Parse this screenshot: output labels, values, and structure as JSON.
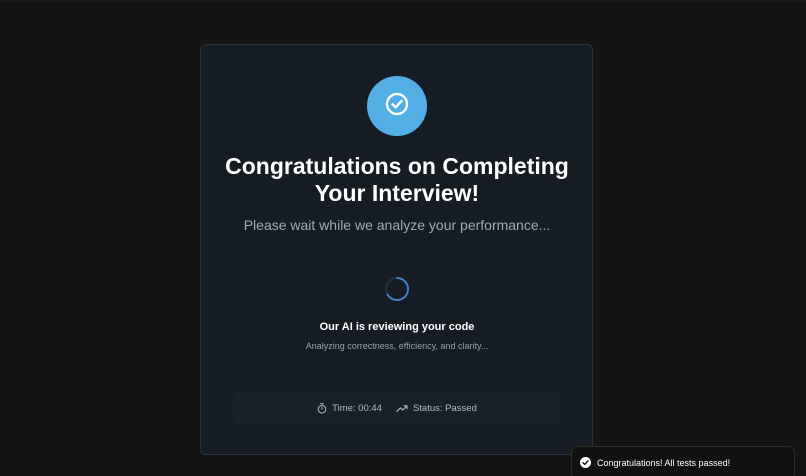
{
  "card": {
    "title": "Congratulations on Completing Your Interview!",
    "subtitle": "Please wait while we analyze your performance...",
    "review_title": "Our AI is reviewing your code",
    "review_subtitle": "Analyzing correctness, efficiency, and clarity...",
    "badge_icon": "check-icon",
    "badge_color": "#53aee6"
  },
  "stats": {
    "time_label": "Time: 00:44",
    "time_icon": "stopwatch-icon",
    "status_label": "Status: Passed",
    "status_icon": "trending-up-icon"
  },
  "toast": {
    "message": "Congratulations! All tests passed!",
    "icon": "check-circle-icon"
  },
  "colors": {
    "background": "#141414",
    "card": "#161c24",
    "spinner": "#3f7fc7"
  }
}
